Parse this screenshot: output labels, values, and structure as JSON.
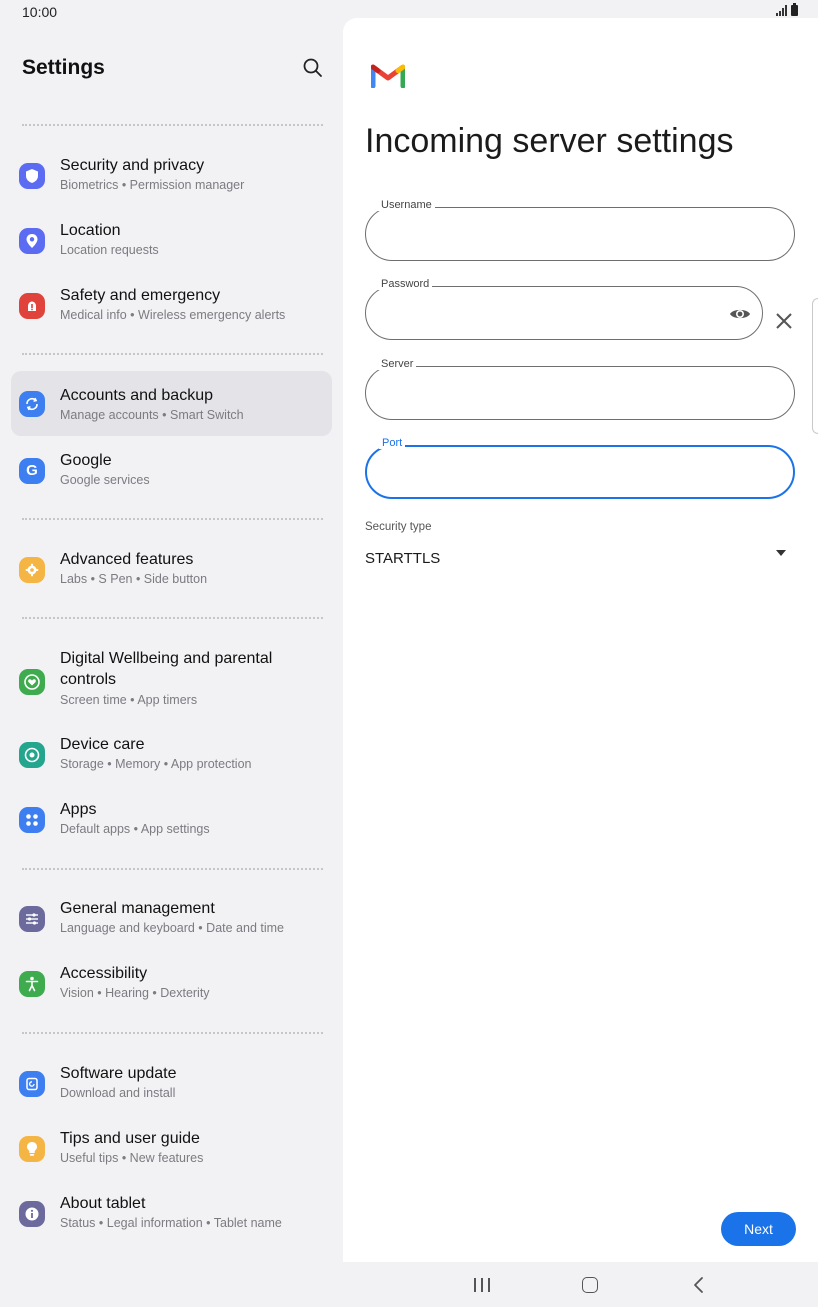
{
  "status_bar": {
    "time": "10:00"
  },
  "settings": {
    "title": "Settings",
    "items": [
      {
        "title": "Security and privacy",
        "subtitle": "Biometrics  •  Permission manager",
        "icon": "shield-icon",
        "color": "#5b6cf2"
      },
      {
        "title": "Location",
        "subtitle": "Location requests",
        "icon": "location-pin-icon",
        "color": "#5b6cf2"
      },
      {
        "title": "Safety and emergency",
        "subtitle": "Medical info  •  Wireless emergency alerts",
        "icon": "emergency-icon",
        "color": "#e0433b"
      },
      {
        "title": "Accounts and backup",
        "subtitle": "Manage accounts  •  Smart Switch",
        "icon": "sync-icon",
        "color": "#3d7ef0"
      },
      {
        "title": "Google",
        "subtitle": "Google services",
        "icon": "google-icon",
        "color": "#3d7ef0"
      },
      {
        "title": "Advanced features",
        "subtitle": "Labs  •  S Pen  •  Side button",
        "icon": "puzzle-star-icon",
        "color": "#f5b544"
      },
      {
        "title": "Digital Wellbeing and parental controls",
        "subtitle": "Screen time  •  App timers",
        "icon": "wellbeing-heart-icon",
        "color": "#3fab4f"
      },
      {
        "title": "Device care",
        "subtitle": "Storage  •  Memory  •  App protection",
        "icon": "device-care-icon",
        "color": "#23a58e"
      },
      {
        "title": "Apps",
        "subtitle": "Default apps  •  App settings",
        "icon": "apps-grid-icon",
        "color": "#3d7ef0"
      },
      {
        "title": "General management",
        "subtitle": "Language and keyboard  •  Date and time",
        "icon": "sliders-icon",
        "color": "#6c6a9c"
      },
      {
        "title": "Accessibility",
        "subtitle": "Vision  •  Hearing  •  Dexterity",
        "icon": "accessibility-icon",
        "color": "#3fab4f"
      },
      {
        "title": "Software update",
        "subtitle": "Download and install",
        "icon": "software-update-icon",
        "color": "#3d7ef0"
      },
      {
        "title": "Tips and user guide",
        "subtitle": "Useful tips  •  New features",
        "icon": "lightbulb-icon",
        "color": "#f5b544"
      },
      {
        "title": "About tablet",
        "subtitle": "Status  •  Legal information  •  Tablet name",
        "icon": "info-icon",
        "color": "#6c6a9c"
      }
    ]
  },
  "incoming": {
    "title": "Incoming server settings",
    "fields": {
      "username": {
        "label": "Username",
        "value": ""
      },
      "password": {
        "label": "Password",
        "value": ""
      },
      "server": {
        "label": "Server",
        "value": ""
      },
      "port": {
        "label": "Port",
        "value": ""
      }
    },
    "security": {
      "label": "Security type",
      "value": "STARTTLS"
    },
    "next_label": "Next"
  },
  "colors": {
    "accent": "#1a73e8",
    "panel_bg": "#f2f2f5",
    "active_item_bg": "#e4e4e8"
  }
}
